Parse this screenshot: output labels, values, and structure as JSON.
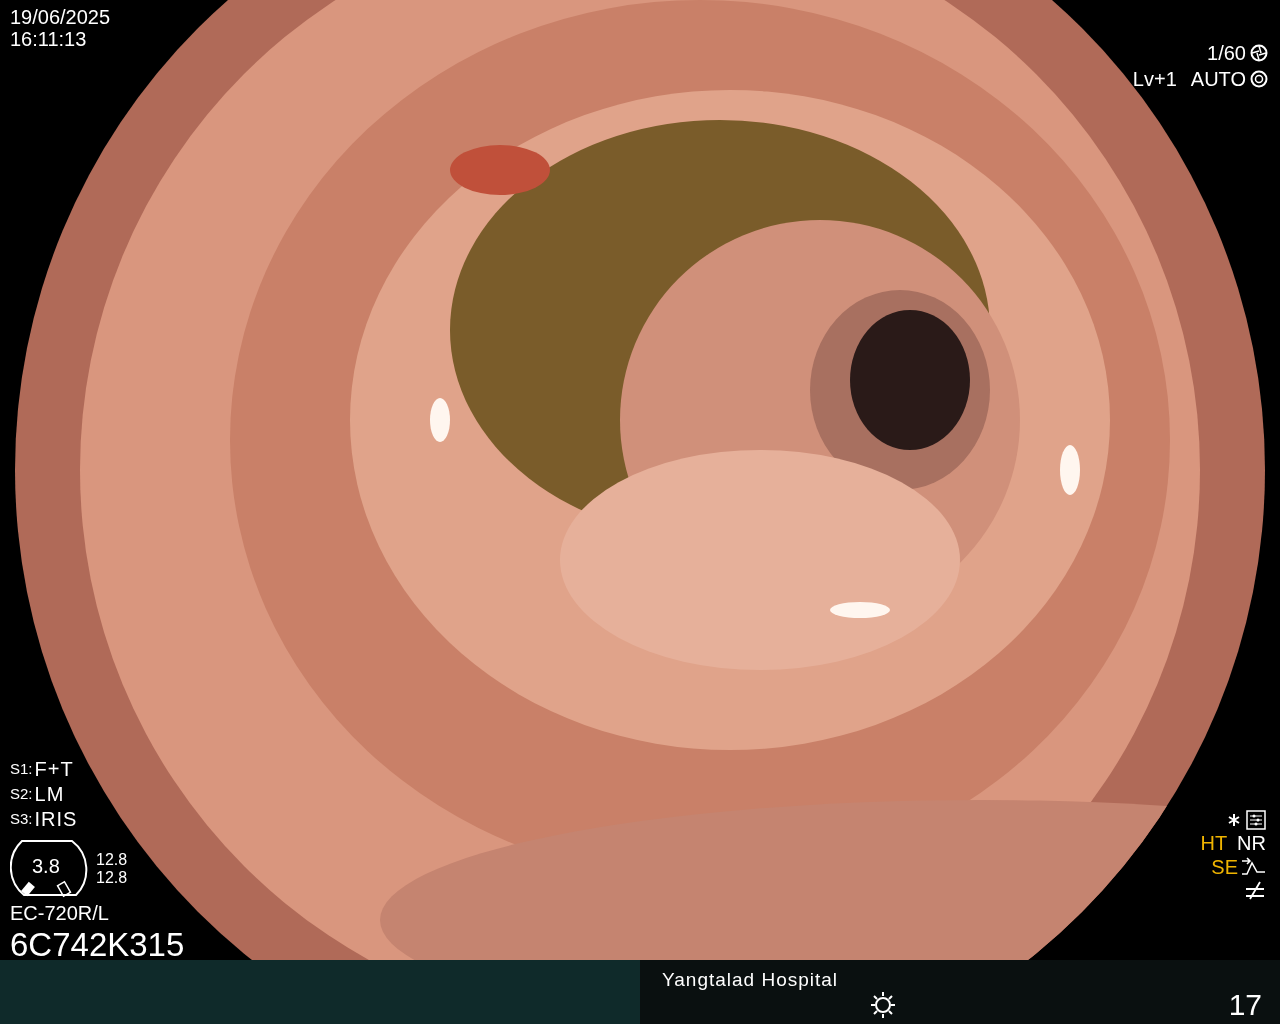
{
  "datetime": {
    "date": "19/06/2025",
    "time": "16:11:13"
  },
  "exposure": {
    "shutter": "1/60",
    "level": "Lv+1",
    "mode": "AUTO"
  },
  "switches": [
    {
      "key": "S1:",
      "value": "F+T"
    },
    {
      "key": "S2:",
      "value": "LM"
    },
    {
      "key": "S3:",
      "value": "IRIS"
    }
  ],
  "scope": {
    "gauge": "3.8",
    "readings": [
      "12.8",
      "12.8"
    ],
    "model": "EC-720R/L",
    "serial": "6C742K315"
  },
  "enhancements": [
    {
      "label": "HT",
      "color": "#f0b400"
    },
    {
      "label": "NR",
      "color": "#ffffff"
    },
    {
      "label": "SE",
      "color": "#f0b400"
    }
  ],
  "status_bar": {
    "hospital": "Yangtalad Hospital",
    "count": "17"
  }
}
